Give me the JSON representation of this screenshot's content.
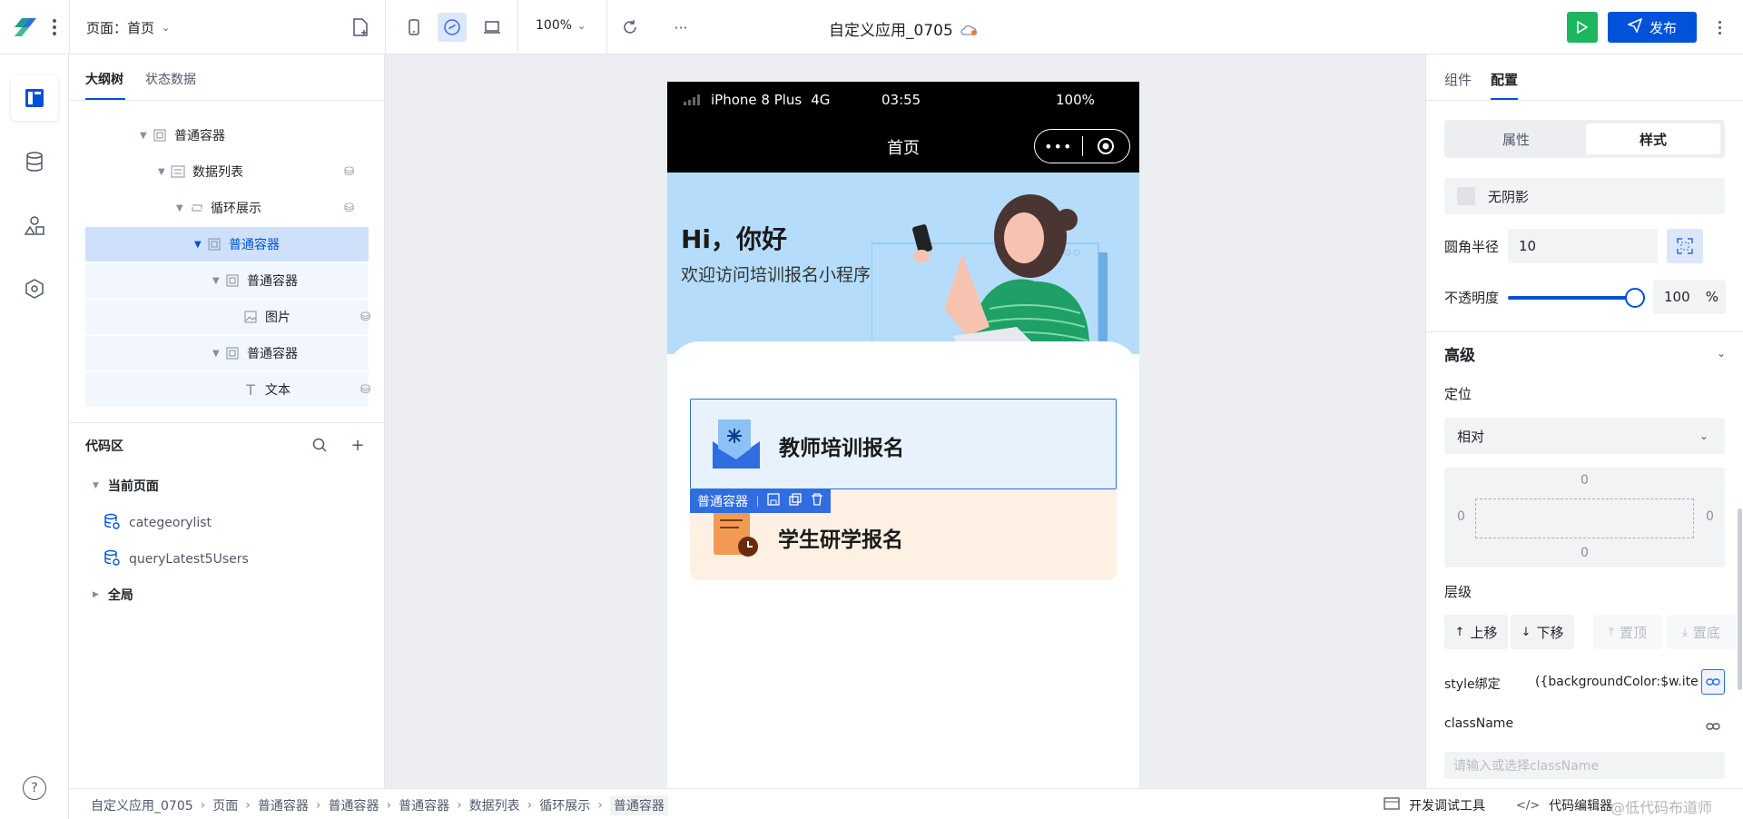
{
  "topbar": {
    "page_label": "页面：首页",
    "zoom": "100%",
    "app_title": "自定义应用_0705",
    "publish_label": "发布"
  },
  "left_panel": {
    "tab_outline": "大纲树",
    "tab_state": "状态数据",
    "tree": [
      {
        "label": "普通容器",
        "icon": "container-icon"
      },
      {
        "label": "数据列表",
        "icon": "list-icon"
      },
      {
        "label": "循环展示",
        "icon": "loop-icon"
      },
      {
        "label": "普通容器",
        "icon": "container-icon"
      },
      {
        "label": "普通容器",
        "icon": "container-icon"
      },
      {
        "label": "图片",
        "icon": "image-icon"
      },
      {
        "label": "普通容器",
        "icon": "container-icon"
      },
      {
        "label": "文本",
        "icon": "text-icon"
      }
    ],
    "code_area_title": "代码区",
    "current_page_label": "当前页面",
    "code_items": [
      "categeorylist",
      "queryLatest5Users"
    ],
    "global_label": "全局"
  },
  "phone": {
    "device": "iPhone 8 Plus",
    "network": "4G",
    "time": "03:55",
    "battery": "100%",
    "nav_title": "首页",
    "greeting": "Hi，你好",
    "subtitle": "欢迎访问培训报名小程序",
    "card1_title": "教师培训报名",
    "card2_title": "学生研学报名",
    "selection_label": "普通容器"
  },
  "right_panel": {
    "tab_components": "组件",
    "tab_config": "配置",
    "seg_props": "属性",
    "seg_style": "样式",
    "shadow_label": "无阴影",
    "radius_label": "圆角半径",
    "radius_value": "10",
    "opacity_label": "不透明度",
    "opacity_value": "100",
    "opacity_unit": "%",
    "opacity_level": 1.0,
    "advanced_title": "高级",
    "position_label": "定位",
    "position_value": "相对",
    "box_top": "0",
    "box_left": "0",
    "box_right": "0",
    "box_bottom": "0",
    "zindex_label": "层级",
    "move_up": "上移",
    "move_down": "下移",
    "to_top": "置顶",
    "to_bottom": "置底",
    "style_binding_label": "style绑定",
    "style_binding_value": "({backgroundColor:$w.ite...",
    "classname_label": "className",
    "classname_placeholder": "请输入或选择className"
  },
  "breadcrumb": [
    "自定义应用_0705",
    "页面",
    "普通容器",
    "普通容器",
    "普通容器",
    "数据列表",
    "循环展示",
    "普通容器"
  ],
  "bottom": {
    "devtools_label": "开发调试工具",
    "code_editor_label": "代码编辑器",
    "watermark": "@低代码布道师"
  },
  "colors": {
    "accent": "#0052d9",
    "run_green": "#1bb65d",
    "hero_blue": "#b5ddfb",
    "card1_bg": "#e8f2fd",
    "card2_bg": "#fef1e4"
  }
}
